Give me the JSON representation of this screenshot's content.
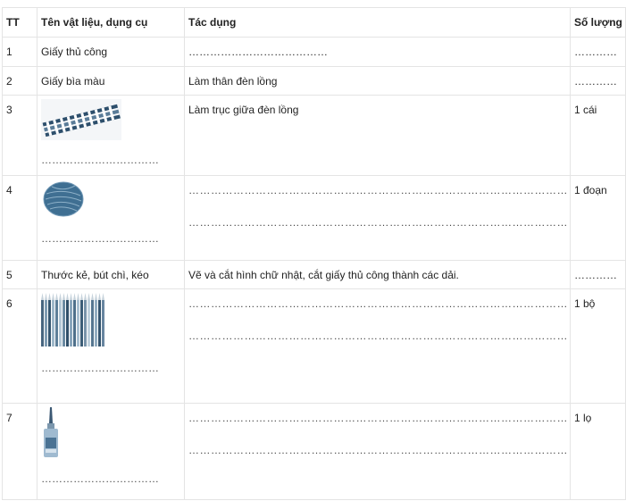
{
  "headers": {
    "tt": "TT",
    "material": "Tên vật liệu, dụng cụ",
    "usage": "Tác dụng",
    "qty": "Số lượng"
  },
  "rows": [
    {
      "tt": "1",
      "material": "Giấy thủ công",
      "usage": "…………………………………",
      "qty": "…………"
    },
    {
      "tt": "2",
      "material": "Giấy bìa màu",
      "usage": "Làm thân đèn lồng",
      "qty": "…………"
    },
    {
      "tt": "3",
      "material": "……………………………",
      "usage": "Làm trục giữa đèn lồng",
      "qty": "1 cái",
      "icon": "striped-straws-icon"
    },
    {
      "tt": "4",
      "material": "……………………………",
      "usage_lines": [
        "…………………………………………………………………………………………",
        "…………………………………………………………………………………………"
      ],
      "qty": "1 đoạn",
      "icon": "yarn-ball-icon"
    },
    {
      "tt": "5",
      "material": "Thước kẻ, bút chì, kéo",
      "usage": "Vẽ và cắt hình chữ nhật, cắt giấy thủ công thành các dải.",
      "qty": "…………"
    },
    {
      "tt": "6",
      "material": "……………………………",
      "usage_lines": [
        "…………………………………………………………………………………………",
        "…………………………………………………………………………………………"
      ],
      "qty": "1 bộ",
      "icon": "color-pencils-icon"
    },
    {
      "tt": "7",
      "material": "……………………………",
      "usage_lines": [
        "…………………………………………………………………………………………",
        "…………………………………………………………………………………………"
      ],
      "qty": "1 lọ",
      "icon": "glue-bottle-icon"
    }
  ]
}
